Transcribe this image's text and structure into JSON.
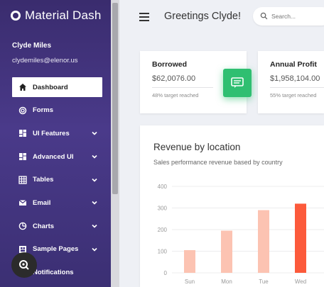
{
  "brand": {
    "title": "Material Dash"
  },
  "user": {
    "name": "Clyde Miles",
    "email": "clydemiles@elenor.us"
  },
  "nav": [
    {
      "label": "Dashboard",
      "icon": "home-icon",
      "active": true,
      "expandable": false
    },
    {
      "label": "Forms",
      "icon": "forms-icon",
      "active": false,
      "expandable": false
    },
    {
      "label": "UI Features",
      "icon": "dashboard-icon",
      "active": false,
      "expandable": true
    },
    {
      "label": "Advanced UI",
      "icon": "dashboard-icon",
      "active": false,
      "expandable": true
    },
    {
      "label": "Tables",
      "icon": "grid-icon",
      "active": false,
      "expandable": true
    },
    {
      "label": "Email",
      "icon": "email-icon",
      "active": false,
      "expandable": true
    },
    {
      "label": "Charts",
      "icon": "pie-chart-icon",
      "active": false,
      "expandable": true
    },
    {
      "label": "Sample Pages",
      "icon": "pages-icon",
      "active": false,
      "expandable": true
    },
    {
      "label": "Notifications",
      "icon": "bell-icon",
      "active": false,
      "expandable": false
    }
  ],
  "topbar": {
    "greeting": "Greetings Clyde!",
    "search_placeholder": "Search..."
  },
  "stats": [
    {
      "label": "Borrowed",
      "value": "$62,0076.00",
      "sub": "48% target reached"
    },
    {
      "label": "Annual Profit",
      "value": "$1,958,104.00",
      "sub": "55% target reached"
    }
  ],
  "colors": {
    "sidebar": "#3a2c6e",
    "accent_green": "#2fbf71",
    "bar_light": "#fcc3b2",
    "bar_strong": "#fc5a3b"
  },
  "chart_data": {
    "type": "bar",
    "title": "Revenue by location",
    "subtitle": "Sales performance revenue based by country",
    "categories": [
      "Sun",
      "Mon",
      "Tue",
      "Wed"
    ],
    "values": [
      105,
      195,
      290,
      320
    ],
    "highlight_index": 3,
    "ylim": [
      0,
      400
    ],
    "yticks": [
      0,
      100,
      200,
      300,
      400
    ],
    "grid": true
  }
}
